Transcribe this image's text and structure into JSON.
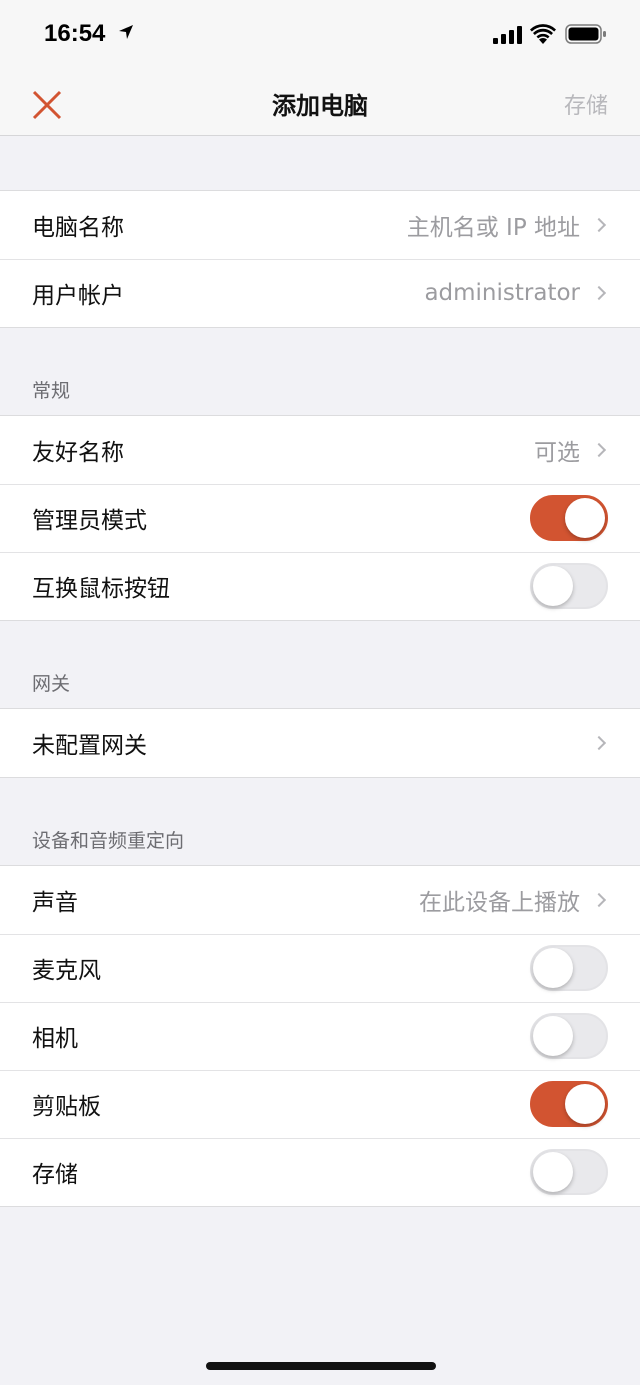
{
  "status_bar": {
    "time": "16:54"
  },
  "nav": {
    "title": "添加电脑",
    "save_label": "存储"
  },
  "colors": {
    "accent": "#d25431",
    "toggle_off": "#e9e9ec",
    "secondary_text": "#9c9ca0"
  },
  "connection": {
    "pc_name_label": "电脑名称",
    "pc_name_placeholder": "主机名或 IP 地址",
    "user_account_label": "用户帐户",
    "user_account_value": "administrator"
  },
  "general": {
    "header": "常规",
    "friendly_name_label": "友好名称",
    "friendly_name_value": "可选",
    "admin_mode_label": "管理员模式",
    "admin_mode_on": true,
    "swap_mouse_label": "互换鼠标按钮",
    "swap_mouse_on": false
  },
  "gateway": {
    "header": "网关",
    "gateway_label": "未配置网关"
  },
  "redirection": {
    "header": "设备和音频重定向",
    "sound_label": "声音",
    "sound_value": "在此设备上播放",
    "microphone_label": "麦克风",
    "microphone_on": false,
    "camera_label": "相机",
    "camera_on": false,
    "clipboard_label": "剪贴板",
    "clipboard_on": true,
    "storage_label": "存储",
    "storage_on": false
  }
}
